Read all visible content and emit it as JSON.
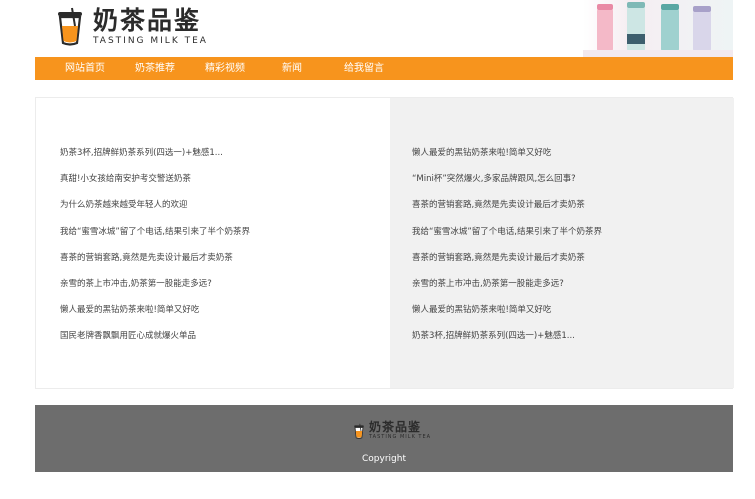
{
  "brand": {
    "name_cn": "奶茶品鉴",
    "name_en": "TASTING MILK TEA"
  },
  "colors": {
    "accent": "#f7941d",
    "footer_bg": "#6d6d6d",
    "right_panel_bg": "#f1f1f1"
  },
  "nav": {
    "items": [
      {
        "label": "网站首页"
      },
      {
        "label": "奶茶推荐"
      },
      {
        "label": "精彩视频"
      },
      {
        "label": "新闻"
      },
      {
        "label": "给我留言"
      }
    ]
  },
  "content": {
    "left": [
      "奶茶3杯,招牌鲜奶茶系列(四选一)+魅感1...",
      "真甜!小女孩给南安护考交警送奶茶",
      "为什么奶茶越来越受年轻人的欢迎",
      "我给“蜜雪冰城”留了个电话,结果引来了半个奶茶界",
      "喜茶的营销套路,竟然是先卖设计最后才卖奶茶",
      "亲雪的茶上市冲击,奶茶第一股能走多远?",
      "懒人最爱的黑钻奶茶来啦!简单又好吃",
      "国民老牌香飘飘用匠心成就爆火单品"
    ],
    "right": [
      "懒人最爱的黑钻奶茶来啦!简单又好吃",
      "“Mini杯”突然爆火,多家品牌跟风,怎么回事?",
      "喜茶的营销套路,竟然是先卖设计最后才卖奶茶",
      "我给“蜜雪冰城”留了个电话,结果引来了半个奶茶界",
      "喜茶的营销套路,竟然是先卖设计最后才卖奶茶",
      "亲雪的茶上市冲击,奶茶第一股能走多远?",
      "懒人最爱的黑钻奶茶来啦!简单又好吃",
      "奶茶3杯,招牌鲜奶茶系列(四选一)+魅感1..."
    ]
  },
  "footer": {
    "copyright": "Copyright"
  }
}
